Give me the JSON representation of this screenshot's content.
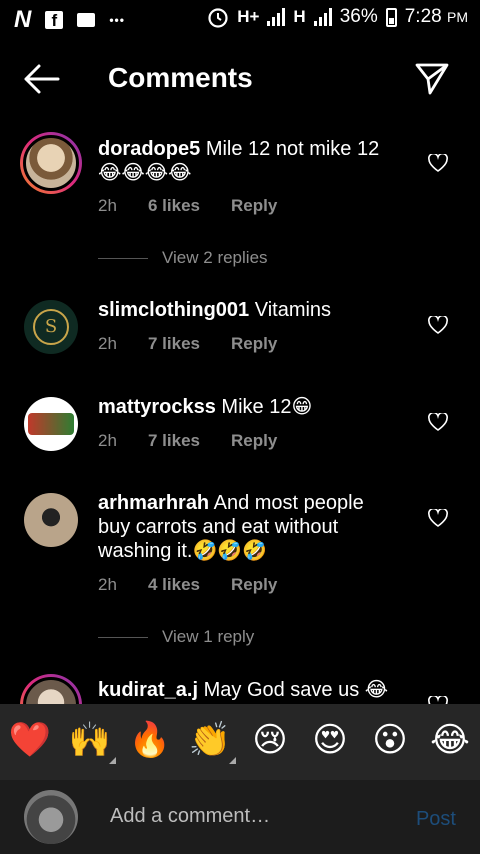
{
  "status": {
    "time": "7:28",
    "ampm": "PM",
    "battery": "36%",
    "net1": "H+",
    "net2": "H",
    "dots": "•••"
  },
  "header": {
    "title": "Comments"
  },
  "comments": [
    {
      "username": "doradope5",
      "text": "Mile 12 not mike 12",
      "emoji": "😂😂😂😂",
      "time": "2h",
      "likes": "6 likes",
      "reply": "Reply",
      "view_replies": "View 2 replies"
    },
    {
      "username": "slimclothing001",
      "text": "Vitamins",
      "emoji": "",
      "time": "2h",
      "likes": "7 likes",
      "reply": "Reply"
    },
    {
      "username": "mattyrockss",
      "text": "Mike 12",
      "emoji": "😁",
      "time": "2h",
      "likes": "7 likes",
      "reply": "Reply"
    },
    {
      "username": "arhmarhrah",
      "text": "And most people buy carrots and eat without washing it.",
      "emoji": "🤣🤣🤣",
      "time": "2h",
      "likes": "4 likes",
      "reply": "Reply",
      "view_replies": "View 1 reply"
    },
    {
      "username": "kudirat_a.j",
      "text": "May God save us",
      "emoji": "😂"
    }
  ],
  "reactions": [
    "❤️",
    "🙌",
    "🔥",
    "👏",
    "😢",
    "😍",
    "😮",
    "😂"
  ],
  "composer": {
    "placeholder": "Add a comment…",
    "post_label": "Post"
  }
}
